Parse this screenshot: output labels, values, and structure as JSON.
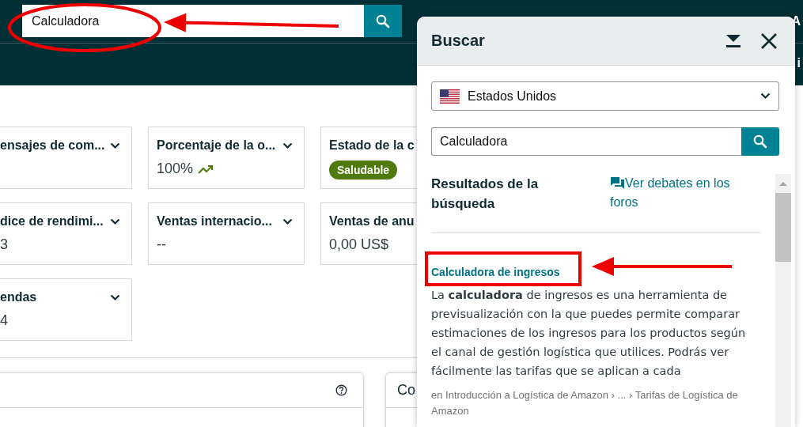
{
  "top_bar": {
    "search": {
      "value": "Calculadora"
    },
    "corner_texts": [
      "A",
      "i"
    ]
  },
  "metric_rows": [
    [
      {
        "title": "ensajes de com...",
        "kind": "none"
      },
      {
        "title": "Porcentaje de la o...",
        "kind": "trend",
        "value": "100%"
      },
      {
        "title": "Estado de la c",
        "kind": "badge",
        "value": "Saludable"
      }
    ],
    [
      {
        "title": "dice de rendimi...",
        "kind": "text",
        "value": "3"
      },
      {
        "title": "Ventas internacio...",
        "kind": "text",
        "value": "--"
      },
      {
        "title": "Ventas de anu",
        "kind": "text",
        "value": "0,00 US$"
      }
    ],
    [
      {
        "title": "endas",
        "kind": "text",
        "value": "4"
      }
    ]
  ],
  "lower_cards": [
    {
      "kind": "help"
    },
    {
      "kind": "title",
      "title": "Co"
    }
  ],
  "search_panel": {
    "title": "Buscar",
    "country": "Estados Unidos",
    "search_value": "Calculadora",
    "results_heading": "Resultados de la búsqueda",
    "forum_link": "Ver debates en los foros",
    "results": [
      {
        "title": "Calculadora de ingresos",
        "snippet": "La **calculadora** de ingresos es una herramienta de previsualización con la que puedes permite comparar estimaciones de los ingresos para los productos según el canal de gestión logística que utilices. Podrás ver fácilmente las tarifas que se aplican a cada",
        "path": "en Introducción a Logística de Amazon › ... › Tarifas de Logística de Amazon"
      }
    ]
  },
  "annotations": [
    {
      "kind": "ellipse"
    },
    {
      "kind": "arrow"
    },
    {
      "kind": "box"
    },
    {
      "kind": "arrow"
    }
  ]
}
